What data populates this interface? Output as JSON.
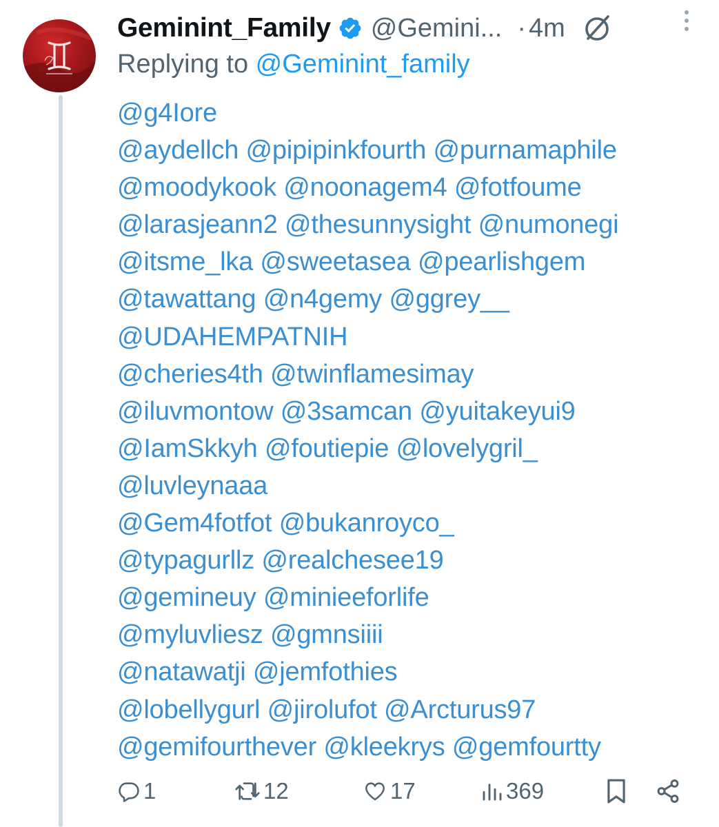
{
  "author": {
    "display_name": "Geminint_Family",
    "handle": "@Gemini...",
    "dot": "·",
    "time": "4m"
  },
  "reply_prefix": "Replying to ",
  "reply_to": "@Geminint_family",
  "mention_lines": [
    "@g4Iore",
    "@aydellch @pipipinkfourth @purnamaphile",
    "@moodykook @noonagem4 @fotfoume",
    "@larasjeann2 @thesunnysight @numonegi",
    "@itsme_lka @sweetasea @pearlishgem",
    "@tawattang @n4gemy @ggrey__",
    "@UDAHEMPATNIH",
    "@cheries4th @twinflamesimay",
    "@iluvmontow @3samcan @yuitakeyui9",
    "@IamSkkyh @foutiepie @lovelygril_",
    "@luvleynaaa",
    "@Gem4fotfot @bukanroyco_",
    "@typagurllz @realchesee19",
    "@gemineuy @minieeforlife",
    "@myluvliesz @gmnsiiii",
    "@natawatji @jemfothies",
    "@lobellygurl @jirolufot @Arcturus97",
    "@gemifourthever @kleekrys @gemfourtty"
  ],
  "actions": {
    "replies": "1",
    "reposts": "12",
    "likes": "17",
    "views": "369"
  },
  "icons": {
    "verified": "verified-badge-icon",
    "grok": "grok-icon",
    "more": "more-vertical-icon",
    "reply": "reply-icon",
    "repost": "repost-icon",
    "like": "heart-icon",
    "views": "views-icon",
    "bookmark": "bookmark-icon",
    "share": "share-icon"
  },
  "colors": {
    "link": "#1d9bf0",
    "secondary_text": "#536471",
    "avatar_red": "#a3181c"
  }
}
